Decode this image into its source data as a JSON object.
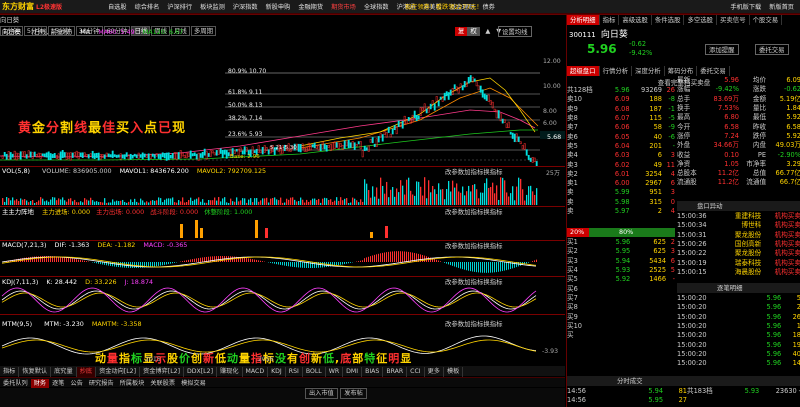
{
  "app": {
    "logo": "东方财富",
    "version": "L2极速版"
  },
  "top_menu": [
    "自选股",
    "综合排名",
    "沪深排行",
    "板块监测",
    "沪深指数",
    "新股申购",
    "金融期货",
    "期货市场",
    "全球指数",
    "沪港通",
    "港美股",
    "基金理财",
    "债券"
  ],
  "top_menu_active_index": 7,
  "promo_text": "现在领券！看跌领2277元！",
  "right_menu": [
    "手机版下载",
    "新版首页"
  ],
  "right_menu2": [
    "分析明细",
    "指标",
    "高级选股",
    "条件选股",
    "多空选股",
    "买卖信号",
    "个股交易"
  ],
  "tabs_row": [
    "分时",
    "K线",
    "多日",
    "F10"
  ],
  "period_buttons": [
    "1分钟",
    "5分钟",
    "15分钟",
    "30分钟",
    "60分钟",
    "日线",
    "周线",
    "月线",
    "多周期"
  ],
  "period_active": "日线",
  "restore_buttons": {
    "fq": "复",
    "qfq": "权",
    "extra": "设置均线"
  },
  "chart_header": {
    "name": "向日葵",
    "mode": "(日线, 前复权)",
    "ma_label": "MA",
    "ma60": "MA60: 5.49",
    "ma120": "MA120: 6.67"
  },
  "fib_levels": [
    "80.9% 10.70",
    "61.8% 9.11",
    "50.0% 8.13",
    "38.2% 7.14",
    "23.6% 5.93",
    "5.21-5.30"
  ],
  "price_axis": [
    "12.00",
    "10.00",
    "8.00",
    "6.00"
  ],
  "price_marker": "5.68",
  "overlay_golden": "黄金分割线最佳买入点已现",
  "overlay_volume": "动量指标显示股价创新低动量指标没有创新低,底部特征明显",
  "bottom_note": "Base: 2.96",
  "vol_panel": {
    "title": "VOL(5,8)",
    "volume": "VOLUME: 836905.000",
    "mavol1": "MAVOL1: 843676.200",
    "mavol2": "MAVOL2: 792709.125",
    "axis": "25万",
    "link": "改参数加指标换指标"
  },
  "main_force_panel": {
    "title": "主主力阵地",
    "a": "主力进场: 0.000",
    "b": "主力出场: 0.000",
    "c": "战斗阶段: 0.000",
    "d": "休整阶段: 1.000",
    "link": "改参数加指标换指标"
  },
  "macd_panel": {
    "title": "MACD(7,21,3)",
    "dif": "DIF: -1.363",
    "dea": "DEA: -1.182",
    "macd": "MACD: -0.365",
    "link": "改参数加指标换指标"
  },
  "kdj_panel": {
    "title": "KDJ(7,11,3)",
    "k": "K: 28.442",
    "d": "D: 33.226",
    "j": "J: 18.874",
    "link": "改参数加指标换指标"
  },
  "mtm_panel": {
    "title": "MTM(9,5)",
    "mtm": "MTM: -3.230",
    "mamtm": "MAMTM: -3.358",
    "link": "改参数加指标换指标",
    "axis_low": "-3.93"
  },
  "x_axis": [
    "2015",
    "2016"
  ],
  "indicator_tabs": [
    "指标",
    "恢复默认",
    "底究量",
    "抄底",
    "资金动向[L2]",
    "资金博弈[L2]",
    "DDX[L2]",
    "赚现化",
    "MACD",
    "KDJ",
    "RSI",
    "BOLL",
    "WR",
    "DMI",
    "BIAS",
    "BRAR",
    "CCI",
    "更多",
    "模板"
  ],
  "indicator_active": [
    "抄底"
  ],
  "status_tabs": [
    "委托队列",
    "财务",
    "逐笔",
    "公告",
    "研究报告",
    "所属板块",
    "关联股票",
    "模拟交易"
  ],
  "status_active": "财务",
  "stock": {
    "code": "300111",
    "name": "向日葵",
    "price": "5.96",
    "change": "-0.62",
    "pct": "-9.42%",
    "btn_alert": "添加提醒",
    "btn_trade": "委托交易"
  },
  "rp_tabs": [
    "超级盘口",
    "行情分析",
    "深度分析",
    "筹码分布",
    "委托交易"
  ],
  "rp_subhead": "查看完整档买卖盘",
  "summary_header": [
    "共128档",
    "5.96",
    "93269",
    "26"
  ],
  "asks": [
    [
      "卖10",
      "6.09",
      "188",
      "-8"
    ],
    [
      "卖9",
      "6.08",
      "187",
      "-1"
    ],
    [
      "卖8",
      "6.07",
      "115",
      "-5"
    ],
    [
      "卖7",
      "6.06",
      "58",
      "-9"
    ],
    [
      "卖6",
      "6.05",
      "40",
      "-6"
    ],
    [
      "卖5",
      "6.04",
      "201",
      "-"
    ],
    [
      "卖4",
      "6.03",
      "6",
      "3"
    ],
    [
      "卖3",
      "6.02",
      "49",
      "11"
    ],
    [
      "卖2",
      "6.01",
      "3254",
      "4"
    ],
    [
      "卖1",
      "6.00",
      "2967",
      "6"
    ],
    [
      "卖",
      "5.99",
      "951",
      "3"
    ],
    [
      "卖",
      "5.98",
      "315",
      "0"
    ],
    [
      "卖",
      "5.97",
      "2",
      "4"
    ]
  ],
  "ratio": [
    "20%",
    "80%"
  ],
  "bids": [
    [
      "买1",
      "5.96",
      "625",
      "2"
    ],
    [
      "买2",
      "5.95",
      "625",
      "3"
    ],
    [
      "买3",
      "5.94",
      "5434",
      "6"
    ],
    [
      "买4",
      "5.93",
      "2525",
      "5"
    ],
    [
      "买5",
      "5.92",
      "1466",
      "-"
    ],
    [
      "买6",
      "",
      ""
    ],
    [
      "买7",
      "",
      ""
    ],
    [
      "买8",
      "",
      ""
    ],
    [
      "买9",
      "",
      ""
    ],
    [
      "买10",
      "",
      ""
    ],
    [
      "买",
      "",
      ""
    ]
  ],
  "total_row": [
    "共183档",
    "5.93",
    "23630",
    "-"
  ],
  "stats": [
    [
      "最新",
      "5.96",
      "均价",
      "6.09"
    ],
    [
      "涨幅",
      "-9.42%",
      "涨跌",
      "-0.62"
    ],
    [
      "总手",
      "83.69万",
      "金额",
      "5.19亿"
    ],
    [
      "换手",
      "7.53%",
      "量比",
      "1.84"
    ],
    [
      "最高",
      "6.80",
      "最低",
      "5.92"
    ],
    [
      "今开",
      "6.58",
      "昨收",
      "6.58"
    ],
    [
      "涨停",
      "7.24",
      "跌停",
      "5.92"
    ],
    [
      "外盘",
      "34.66万",
      "内盘",
      "49.03万"
    ],
    [
      "收益",
      "0.10",
      "PE",
      "-2.90%"
    ],
    [
      "净资",
      "1.05",
      "市净率",
      "3.29"
    ],
    [
      "总股本",
      "11.2亿",
      "总值",
      "66.77亿"
    ],
    [
      "流通股",
      "11.2亿",
      "流通值",
      "66.7亿"
    ]
  ],
  "flow_header": "盘口异动",
  "flows": [
    [
      "15:00:36",
      "重建科技",
      "机构买卖"
    ],
    [
      "15:00:34",
      "博世科",
      "机构买卖"
    ],
    [
      "15:00:31",
      "聚龙股份",
      "机构买卖"
    ],
    [
      "15:00:26",
      "国创高新",
      "机构买卖"
    ],
    [
      "15:00:22",
      "聚龙股份",
      "机构买卖"
    ],
    [
      "15:00:19",
      "瑞泰科技",
      "机构买卖"
    ],
    [
      "15:00:15",
      "海晨股份",
      "机构买卖"
    ]
  ],
  "ticks_header": "逐笔明细",
  "ticks": [
    [
      "15:00:20",
      "5.96",
      "5"
    ],
    [
      "15:00:20",
      "5.96",
      "2"
    ],
    [
      "15:00:20",
      "5.96",
      "26"
    ],
    [
      "15:00:20",
      "5.96",
      "1"
    ],
    [
      "15:00:20",
      "5.96",
      "18"
    ],
    [
      "15:00:20",
      "5.96",
      "19"
    ],
    [
      "15:00:20",
      "5.96",
      "40"
    ],
    [
      "15:00:20",
      "5.96",
      "14"
    ]
  ],
  "minute_header": "分时成交",
  "minute": [
    [
      "14:56",
      "5.94",
      "81"
    ],
    [
      "14:56",
      "5.95",
      "27"
    ]
  ],
  "bottom_status": [
    "出入市值",
    "发布帖"
  ],
  "colors": {
    "up": "#ff3030",
    "down": "#20d020",
    "accent": "#ffd400",
    "brand": "#8a0000"
  }
}
